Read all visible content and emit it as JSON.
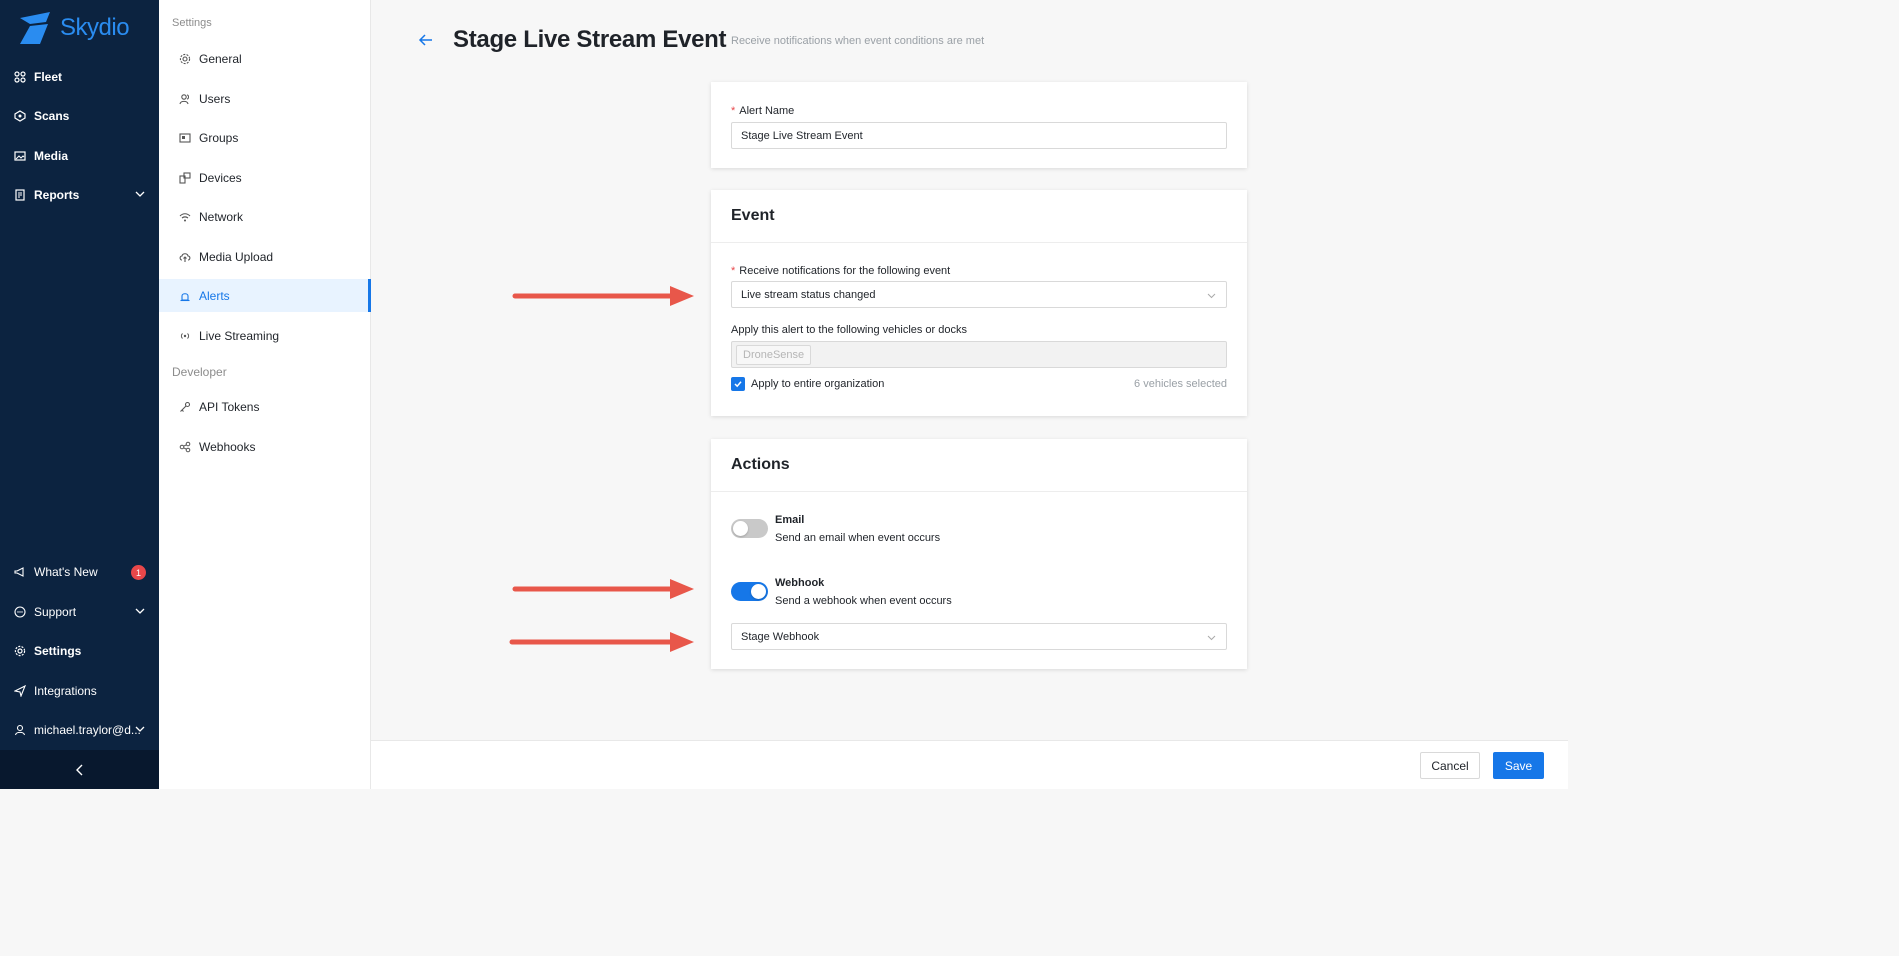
{
  "brand": {
    "name": "Skydio",
    "color": "#2a8cf0"
  },
  "nav": {
    "items": [
      {
        "label": "Fleet",
        "icon": "fleet-icon"
      },
      {
        "label": "Scans",
        "icon": "scans-icon"
      },
      {
        "label": "Media",
        "icon": "media-icon"
      },
      {
        "label": "Reports",
        "icon": "reports-icon"
      }
    ],
    "bottom": [
      {
        "label": "What's New",
        "icon": "megaphone-icon",
        "badge": "1"
      },
      {
        "label": "Support",
        "icon": "chat-icon"
      },
      {
        "label": "Settings",
        "icon": "gear-icon"
      },
      {
        "label": "Integrations",
        "icon": "send-icon"
      },
      {
        "label": "michael.traylor@d...",
        "icon": "user-icon"
      }
    ]
  },
  "settings_nav": {
    "heading": "Settings",
    "items": [
      {
        "label": "General",
        "icon": "gear-icon"
      },
      {
        "label": "Users",
        "icon": "users-icon"
      },
      {
        "label": "Groups",
        "icon": "groups-icon"
      },
      {
        "label": "Devices",
        "icon": "devices-icon"
      },
      {
        "label": "Network",
        "icon": "wifi-icon"
      },
      {
        "label": "Media Upload",
        "icon": "cloud-upload-icon"
      },
      {
        "label": "Alerts",
        "icon": "alarm-icon",
        "active": true
      },
      {
        "label": "Live Streaming",
        "icon": "broadcast-icon"
      }
    ],
    "developer_heading": "Developer",
    "developer_items": [
      {
        "label": "API Tokens",
        "icon": "key-icon"
      },
      {
        "label": "Webhooks",
        "icon": "webhook-icon"
      }
    ]
  },
  "page": {
    "title": "Stage Live Stream Event",
    "subtitle": "Receive notifications when event conditions are met"
  },
  "alert_name": {
    "required_mark": "*",
    "label": "Alert Name",
    "value": "Stage Live Stream Event"
  },
  "event": {
    "heading": "Event",
    "required_mark": "*",
    "event_label": "Receive notifications for the following event",
    "event_value": "Live stream status changed",
    "vehicles_label": "Apply this alert to the following vehicles or docks",
    "vehicles_tag": "DroneSense",
    "apply_org_label": "Apply to entire organization",
    "apply_org_checked": true,
    "vehicles_selected": "6 vehicles selected"
  },
  "actions": {
    "heading": "Actions",
    "email": {
      "title": "Email",
      "desc": "Send an email when event occurs",
      "enabled": false
    },
    "webhook": {
      "title": "Webhook",
      "desc": "Send a webhook when event occurs",
      "enabled": true,
      "selected": "Stage Webhook"
    }
  },
  "footer": {
    "cancel_label": "Cancel",
    "save_label": "Save"
  },
  "colors": {
    "accent": "#1677e8",
    "nav_bg": "#0c2340",
    "annotation_arrow": "#e8574a"
  }
}
